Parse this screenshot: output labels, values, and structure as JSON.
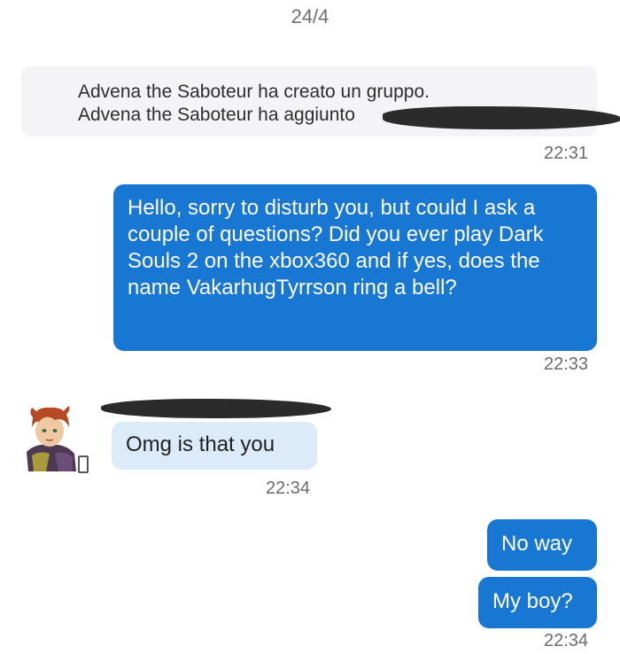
{
  "date_header": "24/4",
  "system_message": {
    "line1": "Advena the Saboteur ha creato un gruppo.",
    "line2": "Advena the Saboteur ha aggiunto",
    "time": "22:31"
  },
  "outgoing_1": {
    "text": "Hello, sorry to disturb you, but could I ask a couple of questions? Did you ever play Dark Souls 2 on the xbox360 and if yes, does the name VakarhugTyrrson ring a bell?",
    "time": "22:33"
  },
  "incoming_1": {
    "text": "Omg is that you",
    "time": "22:34"
  },
  "outgoing_2": {
    "text": "No way"
  },
  "outgoing_3": {
    "text": "My boy?",
    "time": "22:34"
  },
  "colors": {
    "outgoing_bubble": "#1877d2",
    "incoming_bubble": "#dcebfa",
    "system_bg": "#f4f4f6"
  },
  "icons": {
    "device": "phone-icon"
  }
}
